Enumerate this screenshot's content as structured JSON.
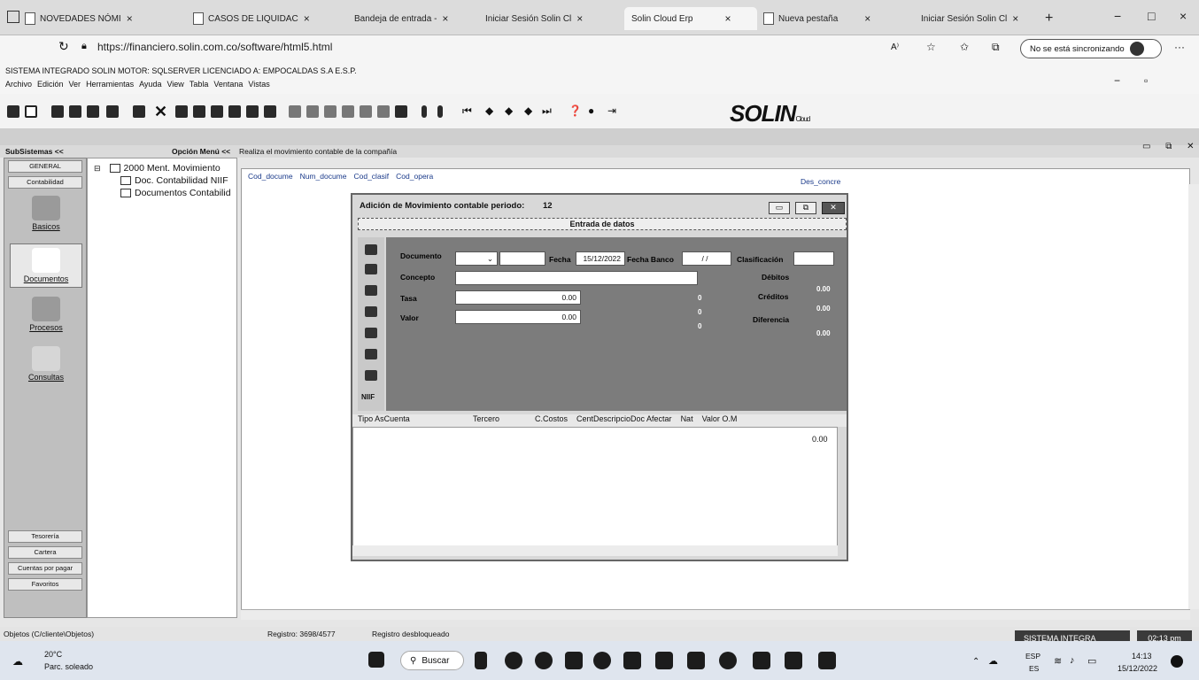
{
  "browser": {
    "tabs": [
      {
        "label": "NOVEDADES NÓMI",
        "active": false
      },
      {
        "label": "CASOS DE LIQUIDAC",
        "active": false
      },
      {
        "label": "Bandeja de entrada -",
        "active": false
      },
      {
        "label": "Iniciar Sesión Solin Cl",
        "active": false
      },
      {
        "label": "Solin Cloud Erp",
        "active": true
      },
      {
        "label": "Nueva pestaña",
        "active": false
      },
      {
        "label": "Iniciar Sesión Solin Cl",
        "active": false
      }
    ],
    "new_tab": "+",
    "url": "https://financiero.solin.com.co/software/html5.html",
    "sync_label": "No se está sincronizando",
    "window_controls": {
      "minimize": "−",
      "maximize": "□",
      "close": "×"
    }
  },
  "app": {
    "title": "SISTEMA INTEGRADO SOLIN MOTOR: SQLSERVER LICENCIADO A: EMPOCALDAS S.A E.S.P.",
    "menu": [
      "Archivo",
      "Edición",
      "Ver",
      "Herramientas",
      "Ayuda",
      "View",
      "Tabla",
      "Ventana",
      "Vistas"
    ],
    "logo": "SOLIN",
    "logo_sub": "Cloud"
  },
  "topline": {
    "subsistemas": "SubSistemas <<",
    "opcion": "Opción Menú <<",
    "description": "Realiza el movimiento contable de la compañía"
  },
  "sidebar": {
    "top_buttons": [
      "GENERAL",
      "Contabilidad"
    ],
    "icons": [
      "Basicos",
      "Documentos",
      "Procesos",
      "Consultas"
    ],
    "bottom_buttons": [
      "Tesorería",
      "Cartera",
      "Cuentas por pagar",
      "Favoritos"
    ]
  },
  "tree": {
    "items": [
      "2000 Ment. Movimiento",
      "Doc. Contabilidad NIIF",
      "Documentos Contabilid"
    ]
  },
  "grid": {
    "columns": [
      "Cod_docume",
      "Num_docume",
      "Cod_clasif",
      "Cod_opera"
    ],
    "right_column": "Des_concre"
  },
  "dialog": {
    "title": "Adición de Movimiento contable periodo:",
    "period": "12",
    "section": "Entrada de datos",
    "labels": {
      "documento": "Documento",
      "fecha": "Fecha",
      "fecha_banco": "Fecha Banco",
      "clasificacion": "Clasificación",
      "concepto": "Concepto",
      "tasa": "Tasa",
      "valor": "Valor",
      "debitos": "Débitos",
      "creditos": "Créditos",
      "diferencia": "Diferencia"
    },
    "values": {
      "fecha": "15/12/2022",
      "fecha_banco": "/ /",
      "tasa": "0.00",
      "valor": "0.00",
      "debitos": "0.00",
      "creditos": "0.00",
      "diferencia": "0.00",
      "zero_a": "0",
      "zero_b": "0",
      "zero_c": "0"
    },
    "nif_label": "NIIF",
    "detail_columns": [
      "Tipo AsCuenta",
      "Tercero",
      "C.Costos",
      "CentDescripcioDoc Afectar",
      "Nat",
      "Valor O.M"
    ],
    "detail_total": "0.00"
  },
  "status": {
    "objetos": "Objetos (C/cliente\\Objetos)",
    "registro": "Registro: 3698/4577",
    "bloqueo": "Registro desbloqueado",
    "sistema": "SISTEMA INTEGRA",
    "time_small": "02:13 pm"
  },
  "taskbar": {
    "weather_temp": "20°C",
    "weather_desc": "Parc. soleado",
    "search": "Buscar",
    "lang": "ESP",
    "lang_sub": "ES",
    "time": "14:13",
    "date": "15/12/2022"
  }
}
